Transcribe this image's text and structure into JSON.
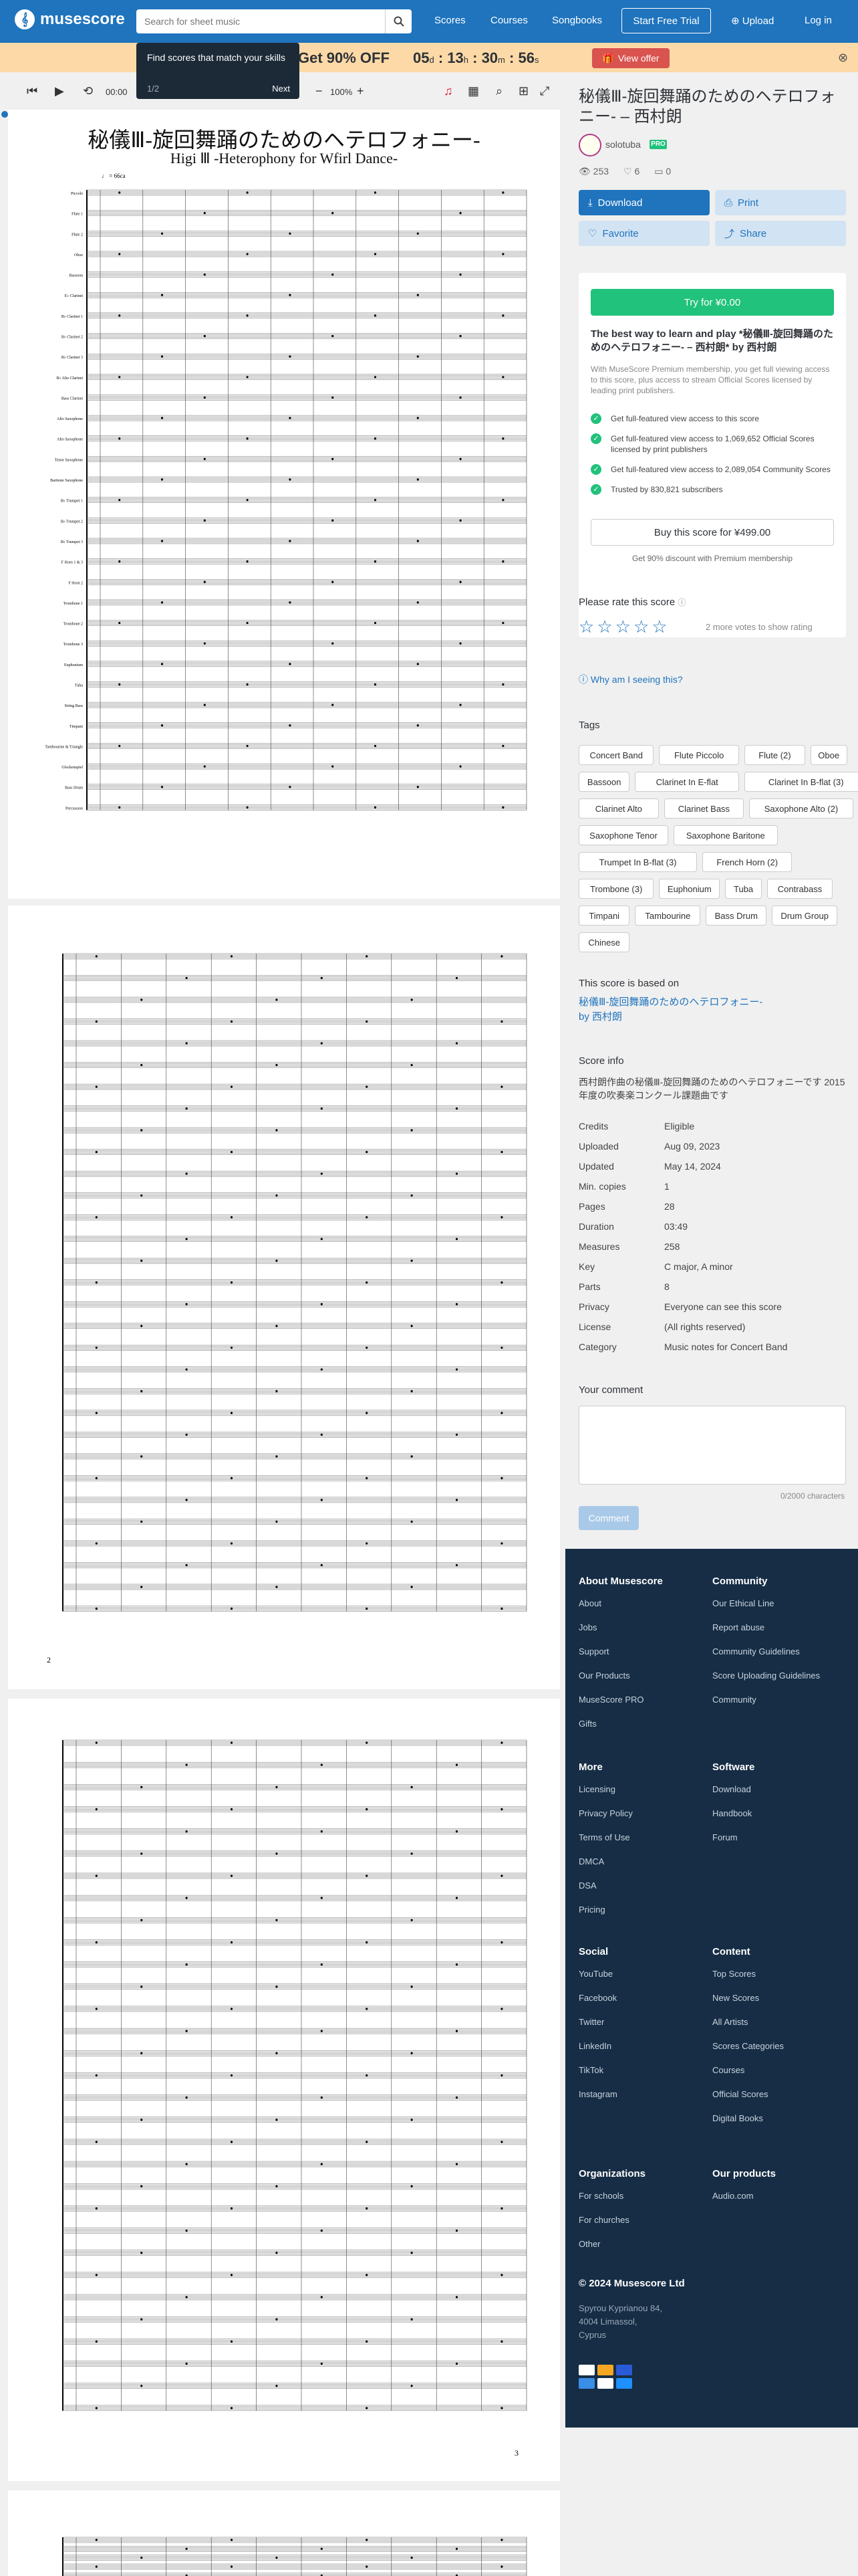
{
  "nav": {
    "logo_text": "musescore",
    "search_placeholder": "Search for sheet music",
    "links": [
      "Scores",
      "Courses",
      "Songbooks"
    ],
    "trial_label": "Start Free Trial",
    "upload_label": "Upload",
    "login_label": "Log in"
  },
  "promo": {
    "text": "Get 90% OFF",
    "countdown": {
      "days": "05",
      "d": "d",
      "hours": "13",
      "h": "h",
      "minutes": "30",
      "m": "m",
      "seconds": "56",
      "s": "s"
    },
    "offer_label": "View offer"
  },
  "tooltip": {
    "title": "Find scores that match your skills",
    "count": "1/2",
    "next": "Next"
  },
  "toolbar": {
    "time": "00:00",
    "zoom": "100%"
  },
  "score": {
    "title": "秘儀Ⅲ-旋回舞踊のためのヘテロフォニー-",
    "subtitle": "Higi Ⅲ -Heterophony for Wfirl Dance-",
    "page1_tempo": "♩ = 66ca",
    "page2_number": "2",
    "page3_number": "3",
    "instruments": [
      "Piccolo",
      "Flute 1",
      "Flute 2",
      "Oboe",
      "Bassoon",
      "E♭ Clarinet",
      "B♭ Clarinet 1",
      "B♭ Clarinet 2",
      "B♭ Clarinet 3",
      "B♭ Alto Clarinet",
      "Bass Clarinet",
      "Alto Saxophone",
      "Alto Saxophone",
      "Tenor Saxophone",
      "Baritone Saxophone",
      "B♭ Trumpet 1",
      "B♭ Trumpet 2",
      "B♭ Trumpet 3",
      "F Horn 1 & 3",
      "F Horn 2",
      "Trombone 1",
      "Trombone 2",
      "Trombone 3",
      "Euphonium",
      "Tuba",
      "String Bass",
      "Timpani",
      "Tambourine & Triangle",
      "Glockenspiel",
      "Bass Drum",
      "Percussion"
    ]
  },
  "sidebar": {
    "title": "秘儀Ⅲ-旋回舞踊のためのヘテロフォニー- – 西村朗",
    "author": "solotuba",
    "pro_badge": "PRO",
    "views": "253",
    "favorites": "6",
    "comments": "0",
    "download_label": "Download",
    "print_label": "Print",
    "favorite_label": "Favorite",
    "share_label": "Share",
    "try_label": "Try for ¥0.00",
    "premium_heading": "The best way to learn and play *秘儀Ⅲ-旋回舞踊のためのヘテロフォニー- – 西村朗* by 西村朗",
    "premium_desc": "With MuseScore Premium membership, you get full viewing access to this score, plus access to stream Official Scores licensed by leading print publishers.",
    "benefits": [
      "Get full-featured view access to this score",
      "Get full-featured view access to 1,069,652 Official Scores licensed by print publishers",
      "Get full-featured view access to 2,089,054 Community Scores",
      "Trusted by 830,821 subscribers"
    ],
    "buy_label": "Buy this score for ¥499.00",
    "discount_text": "Get 90% discount with Premium membership",
    "rate_title": "Please rate this score",
    "rate_note": "2 more votes to show rating",
    "why_label": "Why am I seeing this?",
    "tags_title": "Tags",
    "tags": [
      "Concert Band",
      "Flute Piccolo",
      "Flute (2)",
      "Oboe",
      "Bassoon",
      "Clarinet In E-flat",
      "Clarinet In B-flat (3)",
      "Clarinet Alto",
      "Clarinet Bass",
      "Saxophone Alto (2)",
      "Saxophone Tenor",
      "Saxophone Baritone",
      "Trumpet In B-flat (3)",
      "French Horn (2)",
      "Trombone (3)",
      "Euphonium",
      "Tuba",
      "Contrabass",
      "Timpani",
      "Tambourine",
      "Bass Drum",
      "Drum Group",
      "Chinese"
    ],
    "based_title": "This score is based on",
    "based_link": "秘儀Ⅲ-旋回舞踊のためのヘテロフォニー- by 西村朗",
    "info_title": "Score info",
    "info_desc": "西村朗作曲の秘儀Ⅲ-旋回舞踊のためのヘテロフォニーです 2015年度の吹奏楽コンクール課題曲です",
    "info": [
      {
        "label": "Credits",
        "value": "Eligible"
      },
      {
        "label": "Uploaded",
        "value": "Aug 09, 2023"
      },
      {
        "label": "Updated",
        "value": "May 14, 2024"
      },
      {
        "label": "Min. copies",
        "value": "1"
      },
      {
        "label": "Pages",
        "value": "28"
      },
      {
        "label": "Duration",
        "value": "03:49"
      },
      {
        "label": "Measures",
        "value": "258"
      },
      {
        "label": "Key",
        "value": "C major, A minor"
      },
      {
        "label": "Parts",
        "value": "8"
      },
      {
        "label": "Privacy",
        "value": "Everyone can see this score"
      },
      {
        "label": "License",
        "value": "(All rights reserved)"
      },
      {
        "label": "Category",
        "value": "Music notes for Concert Band"
      }
    ],
    "comment_title": "Your comment",
    "char_count": "0/2000 characters",
    "comment_button": "Comment"
  },
  "footer": {
    "about": {
      "title": "About Musescore",
      "links": [
        "About",
        "Jobs",
        "Support",
        "Our Products",
        "MuseScore PRO",
        "Gifts"
      ]
    },
    "community": {
      "title": "Community",
      "links": [
        "Our Ethical Line",
        "Report abuse",
        "Community Guidelines",
        "Score Uploading Guidelines",
        "Community"
      ]
    },
    "more": {
      "title": "More",
      "links": [
        "Licensing",
        "Privacy Policy",
        "Terms of Use",
        "DMCA",
        "DSA",
        "Pricing"
      ]
    },
    "software": {
      "title": "Software",
      "links": [
        "Download",
        "Handbook",
        "Forum"
      ]
    },
    "social": {
      "title": "Social",
      "links": [
        "YouTube",
        "Facebook",
        "Twitter",
        "LinkedIn",
        "TikTok",
        "Instagram"
      ]
    },
    "content": {
      "title": "Content",
      "links": [
        "Top Scores",
        "New Scores",
        "All Artists",
        "Scores Categories",
        "Courses",
        "Official Scores",
        "Digital Books"
      ]
    },
    "orgs": {
      "title": "Organizations",
      "links": [
        "For schools",
        "For churches",
        "Other"
      ]
    },
    "products": {
      "title": "Our products",
      "links": [
        "Audio.com"
      ]
    },
    "copyright": "© 2024 Musescore Ltd",
    "address": [
      "Spyrou Kyprianou 84,",
      "4004 Limassol,",
      "Cyprus"
    ]
  }
}
